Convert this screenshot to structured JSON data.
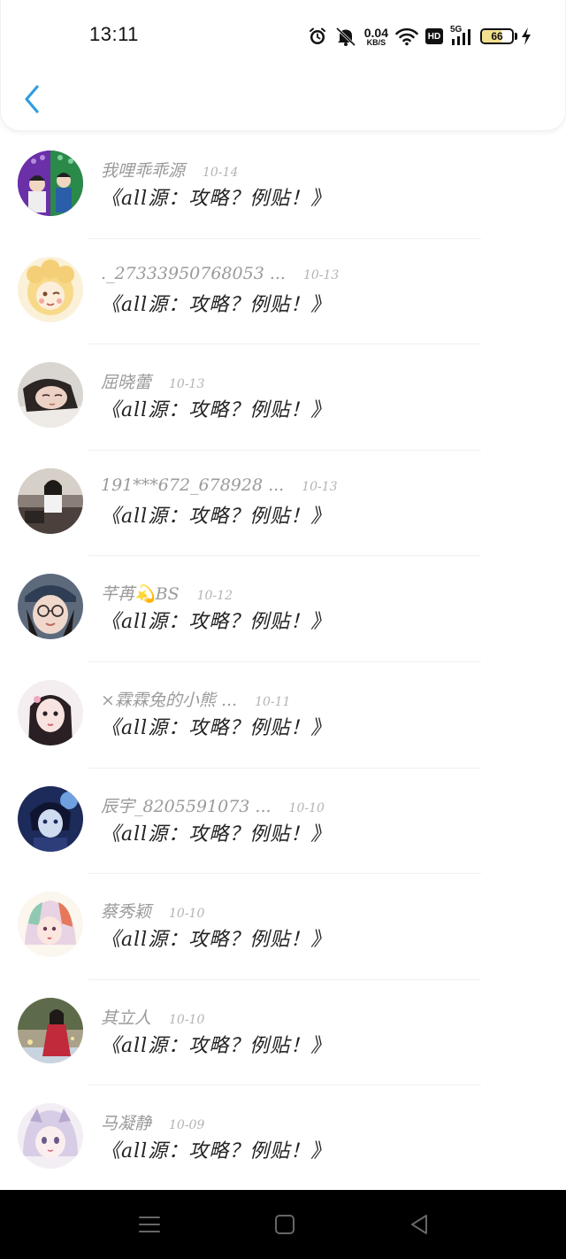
{
  "status_bar": {
    "time": "13:11",
    "net_speed_value": "0.04",
    "net_speed_unit": "KB/S",
    "hd_label": "HD",
    "network_label": "5G",
    "battery_level": "66",
    "battery_fraction": 0.66,
    "icons": [
      "alarm-icon",
      "mute-icon",
      "wifi-icon",
      "hd-icon",
      "signal-icon",
      "battery-icon",
      "charging-icon"
    ]
  },
  "header": {
    "back_icon": "chevron-left-icon",
    "accent_color": "#2f9fe0"
  },
  "list": {
    "items": [
      {
        "name": "我哩乖乖源",
        "date": "10-14",
        "text": "《all源：攻略？例贴！》"
      },
      {
        "name": "._27333950768053 ...",
        "date": "10-13",
        "text": "《all源：攻略？例贴！》"
      },
      {
        "name": "屈晓蕾",
        "date": "10-13",
        "text": "《all源：攻略？例贴！》"
      },
      {
        "name": "191***672_678928 ...",
        "date": "10-13",
        "text": "《all源：攻略？例贴！》"
      },
      {
        "name": "芊苒💫BS",
        "date": "10-12",
        "text": "《all源：攻略？例贴！》"
      },
      {
        "name": "×霖霖兔的小熊 ...",
        "date": "10-11",
        "text": "《all源：攻略？例贴！》"
      },
      {
        "name": "辰宇_8205591073 ...",
        "date": "10-10",
        "text": "《all源：攻略？例贴！》"
      },
      {
        "name": "蔡秀颖",
        "date": "10-10",
        "text": "《all源：攻略？例贴！》"
      },
      {
        "name": "其立人",
        "date": "10-10",
        "text": "《all源：攻略？例贴！》"
      },
      {
        "name": "马凝静",
        "date": "10-09",
        "text": "《all源：攻略？例贴！》"
      }
    ]
  },
  "navbar": {
    "icons": [
      "menu-icon",
      "home-square-icon",
      "back-triangle-icon"
    ]
  }
}
